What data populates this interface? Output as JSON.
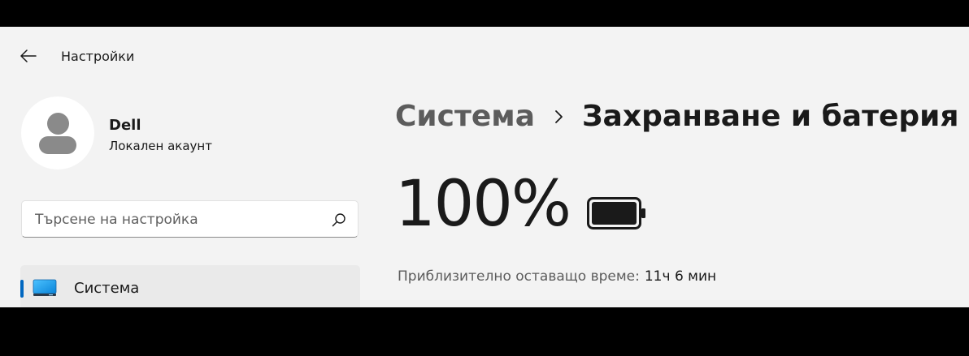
{
  "header": {
    "app_title": "Настройки",
    "back_icon": "arrow-left-icon"
  },
  "user": {
    "name": "Dell",
    "account_type": "Локален акаунт",
    "avatar_icon": "user-avatar-icon"
  },
  "search": {
    "placeholder": "Търсене на настройка",
    "icon": "search-icon"
  },
  "sidebar": {
    "items": [
      {
        "label": "Система",
        "icon": "system-display-icon",
        "selected": true
      }
    ]
  },
  "breadcrumb": {
    "parent": "Система",
    "separator_icon": "chevron-right-icon",
    "current": "Захранване и батерия"
  },
  "battery": {
    "percent_label": "100%",
    "level": 1.0,
    "icon": "battery-full-icon"
  },
  "remaining_time": {
    "label": "Приблизително оставащо време:",
    "value": "11ч 6 мин"
  },
  "colors": {
    "window_bg": "#f3f3f3",
    "accent": "#0067c0",
    "selected_item_bg": "#eaeaea",
    "text_primary": "#1a1a1a",
    "text_secondary": "#5c5c5c"
  }
}
